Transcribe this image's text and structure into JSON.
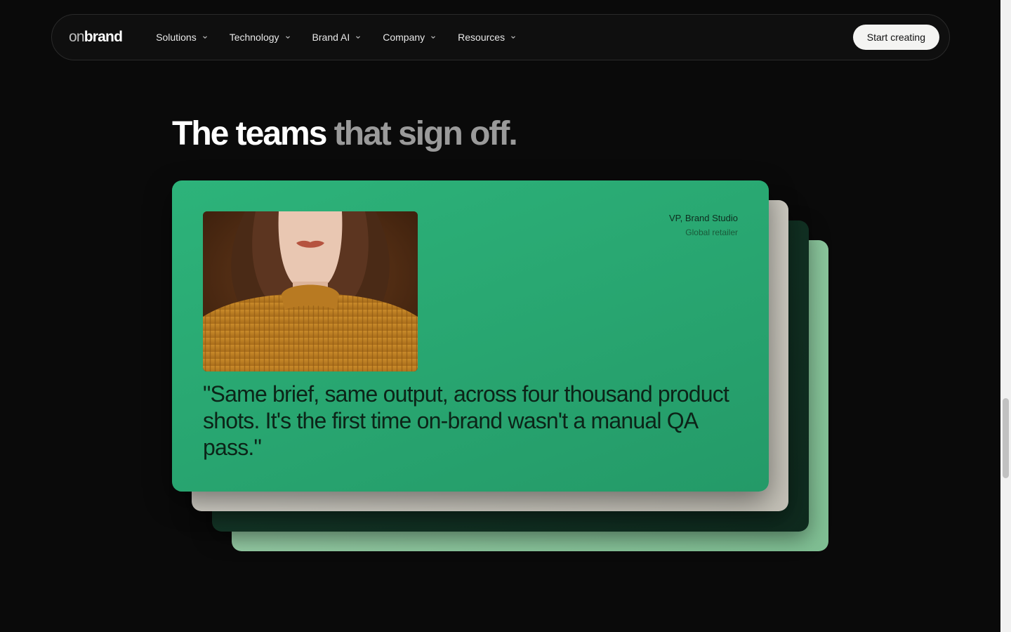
{
  "nav": {
    "logo_light": "on",
    "logo_bold": "brand",
    "items": [
      {
        "label": "Solutions"
      },
      {
        "label": "Technology"
      },
      {
        "label": "Brand AI"
      },
      {
        "label": "Company"
      },
      {
        "label": "Resources"
      }
    ],
    "cta_label": "Start creating"
  },
  "hero": {
    "headline_white": "The teams",
    "headline_gray": "that sign off."
  },
  "testimonial": {
    "role": "VP, Brand Studio",
    "org": "Global retailer",
    "quote": "\"Same brief, same output, across four thousand product shots. It's the first time on-brand wasn't a manual QA pass.\""
  },
  "colors": {
    "background": "#0a0a0a",
    "card_green": "#2db37a",
    "card_cream": "#dcdad2",
    "card_dark_green": "#163a2a",
    "card_mint": "#9fd1ac",
    "quote_text": "#0c2418"
  },
  "icons": {
    "nav_chevron": "chevron-down-icon"
  }
}
